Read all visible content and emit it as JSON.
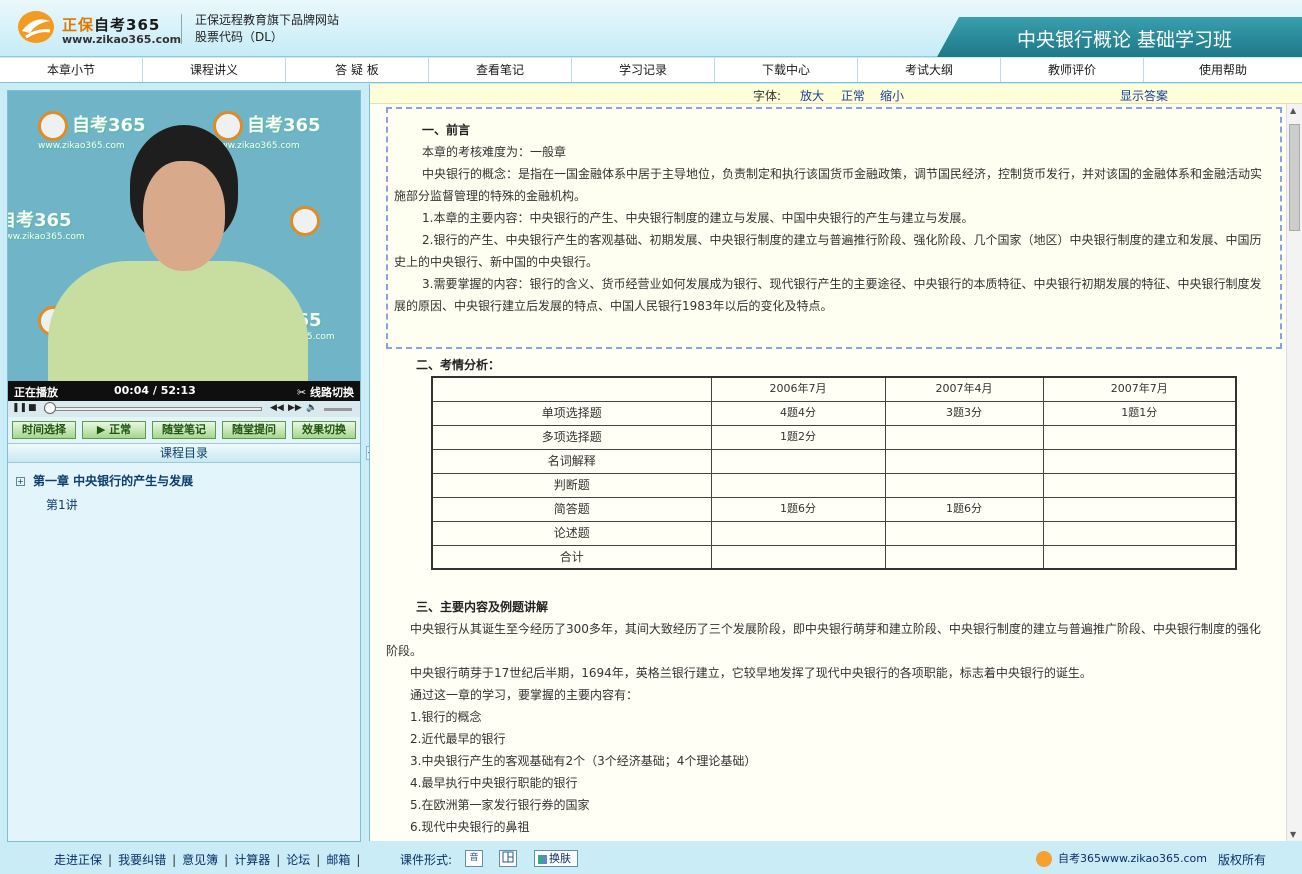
{
  "header": {
    "brand_a": "正保",
    "brand_b": "自考365",
    "site_url": "www.zikao365.com",
    "tagline_1": "正保远程教育旗下品牌网站",
    "tagline_2": "股票代码（DL）",
    "course_title": "中央银行概论 基础学习班"
  },
  "nav": [
    "本章小节",
    "课程讲义",
    "答 疑 板",
    "查看笔记",
    "学习记录",
    "下载中心",
    "考试大纲",
    "教师评价",
    "使用帮助"
  ],
  "video": {
    "watermark_brand": "自考365",
    "watermark_url": "www.zikao365.com",
    "status": "正在播放",
    "time_current": "00:04",
    "time_separator": "/",
    "time_total": "52:13",
    "route_label": "线路切换"
  },
  "func_buttons": [
    "时间选择",
    "▶ 正常",
    "随堂笔记",
    "随堂提问",
    "效果切换"
  ],
  "catalog": {
    "title": "课程目录",
    "chapter": "第一章  中央银行的产生与发展",
    "lecture": "第1讲"
  },
  "toolbar": {
    "font_label": "字体:",
    "zoom_in": "放大",
    "normal": "正常",
    "zoom_out": "缩小",
    "show_answer": "显示答案"
  },
  "content": {
    "intro_title": "一、前言",
    "intro_paragraphs": [
      "本章的考核难度为：一般章",
      "中央银行的概念：是指在一国金融体系中居于主导地位，负责制定和执行该国货币金融政策，调节国民经济，控制货币发行，并对该国的金融体系和金融活动实施部分监督管理的特殊的金融机构。",
      "1.本章的主要内容：中央银行的产生、中央银行制度的建立与发展、中国中央银行的产生与建立与发展。",
      "2.银行的产生、中央银行产生的客观基础、初期发展、中央银行制度的建立与普遍推行阶段、强化阶段、几个国家（地区）中央银行制度的建立和发展、中国历史上的中央银行、新中国的中央银行。",
      "3.需要掌握的内容：银行的含义、货币经营业如何发展成为银行、现代银行产生的主要途径、中央银行的本质特征、中央银行初期发展的特征、中央银行制度发展的原因、中央银行建立后发展的特点、中国人民银行1983年以后的变化及特点。"
    ],
    "exam_title": "二、考情分析：",
    "exam_table": {
      "headers": [
        "",
        "2006年7月",
        "2007年4月",
        "2007年7月"
      ],
      "rows": [
        [
          "单项选择题",
          "4题4分",
          "3题3分",
          "1题1分"
        ],
        [
          "多项选择题",
          "1题2分",
          "",
          ""
        ],
        [
          "名词解释",
          "",
          "",
          ""
        ],
        [
          "判断题",
          "",
          "",
          ""
        ],
        [
          "简答题",
          "1题6分",
          "1题6分",
          ""
        ],
        [
          "论述题",
          "",
          "",
          ""
        ],
        [
          "合计",
          "",
          "",
          ""
        ]
      ]
    },
    "main_title": "三、主要内容及例题讲解",
    "main_paragraphs": [
      "中央银行从其诞生至今经历了300多年，其间大致经历了三个发展阶段，即中央银行萌芽和建立阶段、中央银行制度的建立与普遍推广阶段、中央银行制度的强化阶段。",
      "中央银行萌芽于17世纪后半期，1694年，英格兰银行建立，它较早地发挥了现代中央银行的各项职能，标志着中央银行的诞生。",
      "通过这一章的学习，要掌握的主要内容有："
    ],
    "main_list": [
      "1.银行的概念",
      "2.近代最早的银行",
      "3.中央银行产生的客观基础有2个（3个经济基础；4个理论基础）",
      "4.最早执行中央银行职能的银行",
      "5.在欧洲第一家发行银行券的国家",
      "6.现代中央银行的鼻祖"
    ]
  },
  "footer": {
    "links": [
      "走进正保",
      "我要纠错",
      "意见簿",
      "计算器",
      "论坛",
      "邮箱"
    ],
    "format_label": "课件形式:",
    "format_audio": "音",
    "skin_label": "换肤",
    "site_text": "自考365www.zikao365.com",
    "copyright": "版权所有"
  },
  "colors": {
    "banner": "#1d7888",
    "nav_border": "#7fc0d6",
    "panel_bg": "#e3f5fb",
    "content_bg": "#fffff5",
    "dashed_border": "#86a3e3",
    "link": "#1a3e9e",
    "brand_orange": "#e07800"
  },
  "icons": [
    "logo-icon",
    "pause-icon",
    "stop-icon",
    "rewind-icon",
    "forward-icon",
    "volume-icon",
    "expand-icon",
    "collapse-icon",
    "skin-icon",
    "scroll-up-icon",
    "scroll-down-icon"
  ]
}
